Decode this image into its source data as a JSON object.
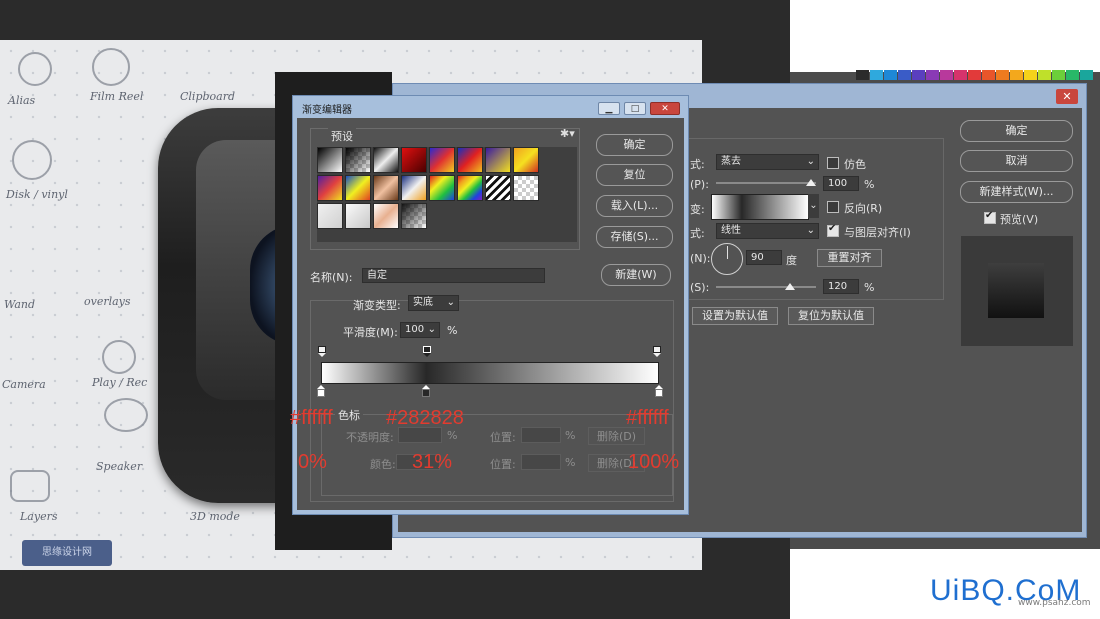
{
  "background": {
    "sketch_labels": [
      "Alias",
      "Film Reel",
      "Clipboard",
      "Disk / vinyl",
      "Wand",
      "overlays",
      "Camera",
      "Play / Rec",
      "Speaker",
      "3D mode",
      "Layers"
    ],
    "watermark": "思缘设计网"
  },
  "gradient_editor": {
    "title": "渐变编辑器",
    "presets_label": "预设",
    "name_label": "名称(N):",
    "name_value": "自定",
    "type_label": "渐变类型:",
    "type_value": "实底",
    "smoothness_label": "平滑度(M):",
    "smoothness_value": "100",
    "smoothness_unit": "%",
    "stops_legend": "色标",
    "opacity_label": "不透明度:",
    "color_label": "颜色:",
    "location_label": "位置:",
    "percent": "%",
    "delete_label": "删除(D)",
    "buttons": {
      "ok": "确定",
      "reset": "复位",
      "load": "载入(L)...",
      "save": "存储(S)...",
      "new": "新建(W)"
    },
    "gradient_stops": [
      {
        "color": "#ffffff",
        "location": 0
      },
      {
        "color": "#282828",
        "location": 31
      },
      {
        "color": "#ffffff",
        "location": 100
      }
    ]
  },
  "annotations": {
    "color_left": "#ffffff",
    "color_mid": "#282828",
    "color_right": "#ffffff",
    "pos_left": "0%",
    "pos_mid": "31%",
    "pos_right": "100%"
  },
  "layer_style": {
    "blend_label": "式:",
    "blend_value": "蒸去",
    "dither_label": "仿色",
    "opacity_label": "(P):",
    "opacity_value": "100",
    "gradient_label": "变:",
    "reverse_label": "反向(R)",
    "style_label": "式:",
    "style_value": "线性",
    "align_label": "与图层对齐(I)",
    "angle_label": "(N):",
    "angle_value": "90",
    "angle_unit": "度",
    "reset_align": "重置对齐",
    "scale_label": "(S):",
    "scale_value": "120",
    "percent": "%",
    "set_default": "设置为默认值",
    "reset_default": "复位为默认值",
    "buttons": {
      "ok": "确定",
      "cancel": "取消",
      "new_style": "新建样式(W)...",
      "preview": "预览(V)"
    }
  },
  "branding": {
    "logo": "UiBQ.CoM",
    "url": "www.psahz.com"
  }
}
